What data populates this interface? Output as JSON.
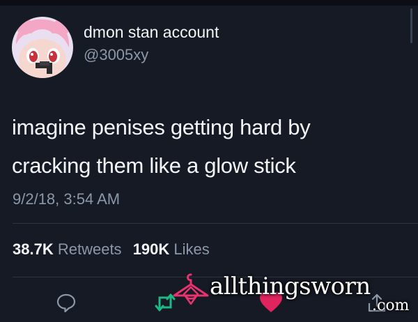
{
  "tweet": {
    "display_name": "dmon stan account",
    "handle": "@3005xy",
    "text_lines": [
      "imagine penises getting hard by",
      "cracking them like a glow stick"
    ],
    "timestamp": "9/2/18, 3:54 AM",
    "stats": {
      "retweets_count": "38.7K",
      "retweets_label": "Retweets",
      "likes_count": "190K",
      "likes_label": "Likes"
    }
  },
  "actions": {
    "icons": [
      "reply-icon",
      "retweet-icon",
      "like-icon",
      "share-icon"
    ]
  },
  "watermark": {
    "brand": "allthingsworn",
    "suffix": ".com"
  },
  "colors": {
    "background": "#151a25",
    "text_primary": "#f2f4f6",
    "text_secondary": "#8c98a8",
    "retweet_green": "#1fb883",
    "like_red": "#e0245e",
    "watermark_pink": "#e8336e"
  }
}
